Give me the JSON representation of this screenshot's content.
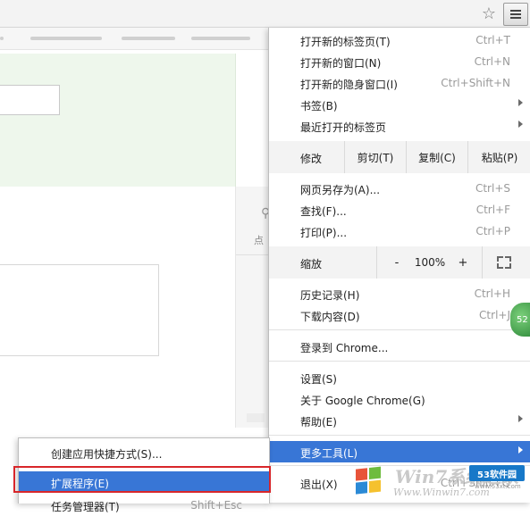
{
  "toolbar": {
    "star_glyph": "☆",
    "menu_icon": "hamburger-menu-icon"
  },
  "page": {
    "side_hint": "点"
  },
  "menu": {
    "items_top": [
      {
        "label": "打开新的标签页(T)",
        "shortcut": "Ctrl+T"
      },
      {
        "label": "打开新的窗口(N)",
        "shortcut": "Ctrl+N"
      },
      {
        "label": "打开新的隐身窗口(I)",
        "shortcut": "Ctrl+Shift+N"
      },
      {
        "label": "书签(B)",
        "has_submenu": true
      },
      {
        "label": "最近打开的标签页",
        "has_submenu": true
      }
    ],
    "edit_row": {
      "label": "修改",
      "cut": "剪切(T)",
      "copy": "复制(C)",
      "paste": "粘贴(P)"
    },
    "items_mid": [
      {
        "label": "网页另存为(A)...",
        "shortcut": "Ctrl+S"
      },
      {
        "label": "查找(F)...",
        "shortcut": "Ctrl+F"
      },
      {
        "label": "打印(P)...",
        "shortcut": "Ctrl+P"
      }
    ],
    "zoom_row": {
      "label": "缩放",
      "minus": "-",
      "value": "100%",
      "plus": "+"
    },
    "history": {
      "label": "历史记录(H)",
      "shortcut": "Ctrl+H"
    },
    "downloads": {
      "label": "下载内容(D)",
      "shortcut": "Ctrl+J"
    },
    "signin": {
      "label": "登录到 Chrome..."
    },
    "settings": {
      "label": "设置(S)"
    },
    "about": {
      "label": "关于 Google Chrome(G)"
    },
    "help": {
      "label": "帮助(E)",
      "has_submenu": true
    },
    "more_tools": {
      "label": "更多工具(L)",
      "has_submenu": true,
      "highlighted": true
    },
    "exit": {
      "label": "退出(X)",
      "shortcut": "Ctrl+Shift+Q"
    },
    "badge": "52"
  },
  "submenu": {
    "items": [
      {
        "label": "创建应用快捷方式(S)..."
      },
      {
        "label": "扩展程序(E)",
        "highlighted": true
      },
      {
        "label": "任务管理器(T)",
        "shortcut": "Shift+Esc"
      }
    ]
  },
  "watermark": {
    "text": "Win7系统之家",
    "url": "Www.Winwin7.com",
    "brand": "53软件园",
    "brand_url": "www.53xt.com"
  },
  "colors": {
    "highlight": "#3876d6",
    "red_frame": "#d8262a",
    "green_panel": "#eef7ec"
  }
}
